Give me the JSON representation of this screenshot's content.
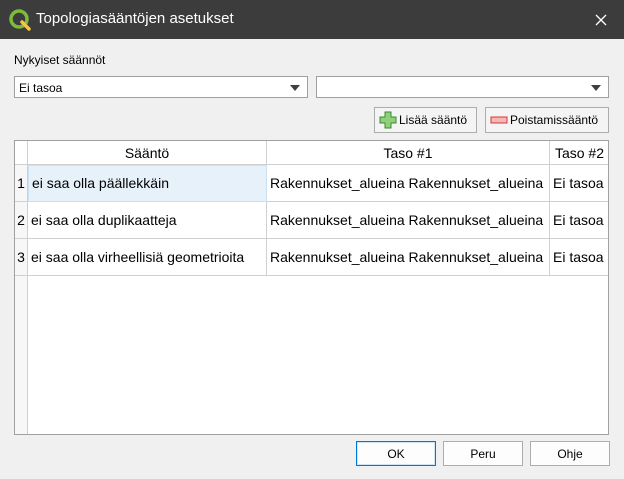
{
  "window": {
    "title": "Topologiasääntöjen asetukset"
  },
  "section": {
    "label": "Nykyiset säännöt"
  },
  "filters": {
    "layer_combo_value": "Ei tasoa",
    "second_combo_value": ""
  },
  "toolbar": {
    "add_rule_label": "Lisää sääntö",
    "delete_rule_label": "Poistamissääntö"
  },
  "table": {
    "columns": [
      "Sääntö",
      "Taso #1",
      "Taso #2"
    ],
    "rows": [
      {
        "num": "1",
        "rule": "ei saa olla päällekkäin",
        "layer1": "Rakennukset_alueina Rakennukset_alueina",
        "layer2": "Ei tasoa"
      },
      {
        "num": "2",
        "rule": "ei saa olla duplikaatteja",
        "layer1": "Rakennukset_alueina Rakennukset_alueina",
        "layer2": "Ei tasoa"
      },
      {
        "num": "3",
        "rule": "ei saa olla virheellisiä geometrioita",
        "layer1": "Rakennukset_alueina Rakennukset_alueina",
        "layer2": "Ei tasoa"
      }
    ]
  },
  "buttons": {
    "ok": "OK",
    "cancel": "Peru",
    "help": "Ohje"
  },
  "colors": {
    "titlebar": "#3c3c3c",
    "selection": "#e7f1fa",
    "accent": "#0078d7"
  }
}
